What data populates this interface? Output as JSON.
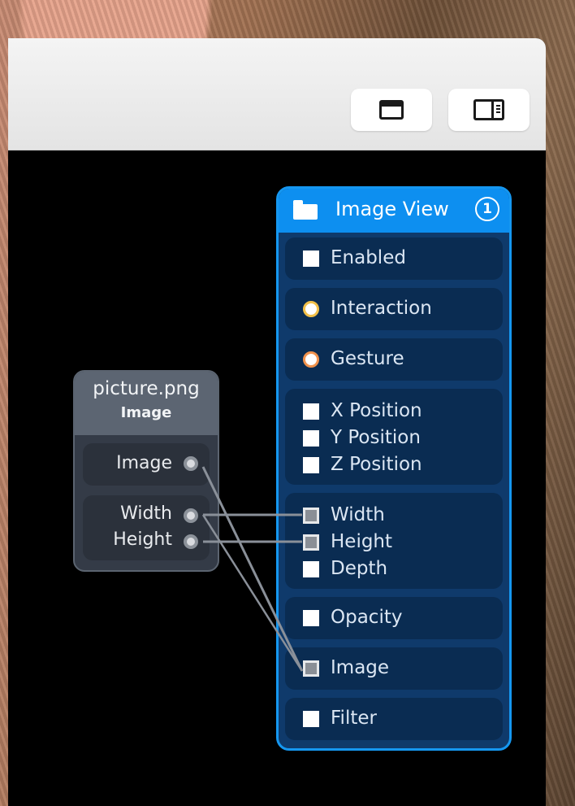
{
  "colors": {
    "node_accent": "#1597f0",
    "node_header": "#0d8ff0",
    "node_body": "#0f3a6b",
    "source_node_body": "#343b47",
    "interaction_port": "#f2c049",
    "gesture_port": "#f0924d",
    "canvas": "#000000"
  },
  "toolbar": {
    "buttons": [
      {
        "icon": "window-layout-icon"
      },
      {
        "icon": "sidebar-panel-icon"
      }
    ]
  },
  "source_node": {
    "title": "picture.png",
    "subtitle": "Image",
    "outputs": [
      "Image",
      "Width",
      "Height"
    ]
  },
  "image_view_node": {
    "icon": "folder-icon",
    "title": "Image View",
    "badge": "1",
    "inputs": {
      "enabled": "Enabled",
      "interaction": "Interaction",
      "gesture": "Gesture",
      "x_position": "X Position",
      "y_position": "Y Position",
      "z_position": "Z Position",
      "width": "Width",
      "height": "Height",
      "depth": "Depth",
      "opacity": "Opacity",
      "image": "Image",
      "filter": "Filter"
    }
  },
  "connections": [
    {
      "from": "Width",
      "to": "Width"
    },
    {
      "from": "Height",
      "to": "Height"
    },
    {
      "from": "Image",
      "to": "Image"
    }
  ]
}
